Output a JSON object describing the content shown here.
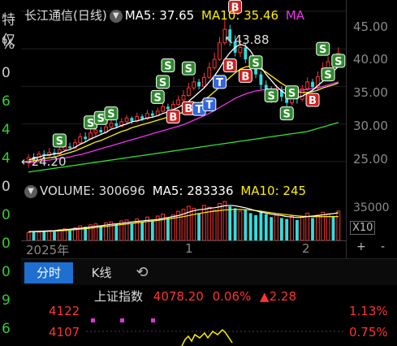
{
  "left_strip": {
    "items": [
      {
        "text": "特仅",
        "color": "#cccccc"
      },
      {
        "text": "%",
        "color": "#cccccc"
      },
      {
        "text": "0",
        "color": "#cccccc"
      },
      {
        "text": "6",
        "color": "#33cc33"
      },
      {
        "text": "4",
        "color": "#33cc33"
      },
      {
        "text": "4",
        "color": "#33cc33"
      },
      {
        "text": "0",
        "color": "#cccccc"
      },
      {
        "text": "0",
        "color": "#33cc33"
      },
      {
        "text": "0",
        "color": "#33cc33"
      },
      {
        "text": "0",
        "color": "#33cc33"
      },
      {
        "text": "9",
        "color": "#33cc33"
      },
      {
        "text": "6",
        "color": "#33cc33"
      }
    ]
  },
  "chart_header": {
    "title": "长江通信(日线)",
    "ma5_label": "MA5: 37.65",
    "ma10_label": "MA10: 35.46",
    "ma_cut": "MA"
  },
  "price_axis": {
    "ticks": [
      "45.00",
      "40.00",
      "35.00",
      "30.00",
      "25.00"
    ]
  },
  "annotations": {
    "high": "43.88",
    "low": "24.20"
  },
  "volume_header": {
    "label": "VOLUME: 300696",
    "ma5": "MA5: 283336",
    "ma10": "MA10: 245"
  },
  "volume_axis": {
    "tick": "35000",
    "unit": "X10",
    "plus": "+",
    "minus": "-"
  },
  "date_labels": {
    "year": "2025年",
    "m1": "1",
    "m2": "2"
  },
  "tabs": {
    "timeshare": "分时",
    "kline": "K线"
  },
  "index_bar": {
    "name": "上证指数",
    "value": "4078.20",
    "pct": "0.06%",
    "change": "▲2.28",
    "y1": "4122",
    "y2": "4107",
    "p1": "1.13%",
    "p2": "0.75%"
  },
  "colors": {
    "up": "#ff3333",
    "down": "#33dddd",
    "ma5": "#ffffff",
    "ma10": "#ffee00",
    "ma20": "#ee33ee",
    "ma60": "#33dd33",
    "buy_marker": "#2e8b2e",
    "sell_marker": "#cc2222",
    "t_marker": "#3366dd",
    "tab_active": "#1e6fd0"
  },
  "chart_data": {
    "type": "candlestick",
    "title": "长江通信(日线)",
    "y_range": [
      22.5,
      46.5
    ],
    "high": 43.88,
    "low": 24.2,
    "candles": [
      [
        24.8,
        25.5,
        24.2,
        26.0
      ],
      [
        25.5,
        25.2,
        24.8,
        26.1
      ],
      [
        25.2,
        26.0,
        25.0,
        26.4
      ],
      [
        26.0,
        25.8,
        25.5,
        26.5
      ],
      [
        25.8,
        26.2,
        25.6,
        26.8
      ],
      [
        26.2,
        26.0,
        25.7,
        26.7
      ],
      [
        26.0,
        26.6,
        25.9,
        27.0
      ],
      [
        26.6,
        27.0,
        26.3,
        27.4
      ],
      [
        27.0,
        26.8,
        26.5,
        27.5
      ],
      [
        26.8,
        27.5,
        26.7,
        28.0
      ],
      [
        27.5,
        28.3,
        27.2,
        28.8
      ],
      [
        28.3,
        28.0,
        27.6,
        28.9
      ],
      [
        28.0,
        28.8,
        27.9,
        29.4
      ],
      [
        28.8,
        29.2,
        28.4,
        29.8
      ],
      [
        29.2,
        28.9,
        28.6,
        29.6
      ],
      [
        28.9,
        29.6,
        28.7,
        30.1
      ],
      [
        29.6,
        30.1,
        29.3,
        30.6
      ],
      [
        30.1,
        29.7,
        29.4,
        30.5
      ],
      [
        29.7,
        30.3,
        29.6,
        30.8
      ],
      [
        30.3,
        30.8,
        30.0,
        31.2
      ],
      [
        30.8,
        30.4,
        30.0,
        31.0
      ],
      [
        30.4,
        31.0,
        30.2,
        31.5
      ],
      [
        31.0,
        30.7,
        30.4,
        31.3
      ],
      [
        30.7,
        31.4,
        30.5,
        31.9
      ],
      [
        31.4,
        31.1,
        30.8,
        31.8
      ],
      [
        31.1,
        31.7,
        31.0,
        32.2
      ],
      [
        31.7,
        32.3,
        31.5,
        32.8
      ],
      [
        32.3,
        32.0,
        31.6,
        32.7
      ],
      [
        32.0,
        32.6,
        31.9,
        33.1
      ],
      [
        32.6,
        33.2,
        32.4,
        33.8
      ],
      [
        33.2,
        33.8,
        33.0,
        34.5
      ],
      [
        33.8,
        34.8,
        33.6,
        35.5
      ],
      [
        34.8,
        35.6,
        34.5,
        36.3
      ],
      [
        35.6,
        35.0,
        34.6,
        36.0
      ],
      [
        35.0,
        36.2,
        34.8,
        36.8
      ],
      [
        36.2,
        37.5,
        36.0,
        38.2
      ],
      [
        37.5,
        38.6,
        37.2,
        39.5
      ],
      [
        38.6,
        40.8,
        38.4,
        41.6
      ],
      [
        40.8,
        42.6,
        40.5,
        43.88
      ],
      [
        42.6,
        41.0,
        40.4,
        43.2
      ],
      [
        41.0,
        39.5,
        39.0,
        41.8
      ],
      [
        39.5,
        40.2,
        38.9,
        41.0
      ],
      [
        40.2,
        38.6,
        38.1,
        40.8
      ],
      [
        38.6,
        37.8,
        37.1,
        39.2
      ],
      [
        37.8,
        36.6,
        36.1,
        38.4
      ],
      [
        36.6,
        35.2,
        34.6,
        37.0
      ],
      [
        35.2,
        34.3,
        33.5,
        35.8
      ],
      [
        34.3,
        33.4,
        32.8,
        35.0
      ],
      [
        33.4,
        34.6,
        33.0,
        35.2
      ],
      [
        34.6,
        33.6,
        33.0,
        35.0
      ],
      [
        33.6,
        32.8,
        32.2,
        34.2
      ],
      [
        32.8,
        33.9,
        32.5,
        34.5
      ],
      [
        33.9,
        33.3,
        32.7,
        34.4
      ],
      [
        33.3,
        34.7,
        33.0,
        35.2
      ],
      [
        34.7,
        35.6,
        34.4,
        36.2
      ],
      [
        35.6,
        34.9,
        34.3,
        36.0
      ],
      [
        34.9,
        36.3,
        34.6,
        37.0
      ],
      [
        36.3,
        37.4,
        36.0,
        38.2
      ],
      [
        37.4,
        38.3,
        37.0,
        39.0
      ],
      [
        38.3,
        38.0,
        37.5,
        39.2
      ],
      [
        38.0,
        39.4,
        37.8,
        40.2
      ]
    ],
    "ma5": [
      25.2,
      25.4,
      25.6,
      25.8,
      25.9,
      26.0,
      26.1,
      26.4,
      26.6,
      26.9,
      27.3,
      27.6,
      28.0,
      28.3,
      28.6,
      28.9,
      29.3,
      29.5,
      29.8,
      30.0,
      30.3,
      30.4,
      30.6,
      30.8,
      30.9,
      31.1,
      31.4,
      31.6,
      31.9,
      32.2,
      32.6,
      33.0,
      33.6,
      34.2,
      34.8,
      35.6,
      36.4,
      37.4,
      38.6,
      39.5,
      40.2,
      40.6,
      40.4,
      39.7,
      38.6,
      37.6,
      36.6,
      35.8,
      35.0,
      34.4,
      33.9,
      33.6,
      33.5,
      33.7,
      34.1,
      34.5,
      35.1,
      35.7,
      36.4,
      37.0,
      37.65
    ],
    "ma10": [
      25.0,
      25.1,
      25.2,
      25.4,
      25.5,
      25.6,
      25.8,
      26.0,
      26.2,
      26.4,
      26.7,
      27.0,
      27.3,
      27.6,
      27.8,
      28.1,
      28.4,
      28.7,
      29.0,
      29.2,
      29.5,
      29.7,
      29.9,
      30.1,
      30.3,
      30.5,
      30.7,
      30.9,
      31.1,
      31.3,
      31.6,
      31.9,
      32.3,
      32.7,
      33.2,
      33.7,
      34.3,
      34.9,
      35.6,
      36.2,
      36.8,
      37.3,
      37.6,
      37.7,
      37.6,
      37.3,
      36.9,
      36.4,
      35.9,
      35.4,
      35.0,
      34.6,
      34.3,
      34.2,
      34.2,
      34.3,
      34.5,
      34.8,
      35.0,
      35.2,
      35.46
    ],
    "ma20": [
      24.8,
      24.9,
      25.0,
      25.1,
      25.2,
      25.3,
      25.4,
      25.5,
      25.6,
      25.8,
      25.9,
      26.1,
      26.3,
      26.5,
      26.7,
      26.9,
      27.1,
      27.3,
      27.5,
      27.7,
      27.9,
      28.1,
      28.3,
      28.5,
      28.7,
      28.9,
      29.1,
      29.3,
      29.5,
      29.7,
      29.9,
      30.2,
      30.5,
      30.8,
      31.1,
      31.4,
      31.8,
      32.2,
      32.6,
      33.0,
      33.4,
      33.7,
      34.0,
      34.2,
      34.4,
      34.5,
      34.6,
      34.6,
      34.6,
      34.6,
      34.5,
      34.5,
      34.5,
      34.5,
      34.6,
      34.7,
      34.8,
      35.0,
      35.2,
      35.4,
      35.6
    ],
    "ma60": [
      23.6,
      23.7,
      23.8,
      23.9,
      24.0,
      24.1,
      24.2,
      24.3,
      24.4,
      24.5,
      24.6,
      24.7,
      24.8,
      24.9,
      25.0,
      25.1,
      25.2,
      25.3,
      25.4,
      25.5,
      25.6,
      25.7,
      25.8,
      25.9,
      26.0,
      26.1,
      26.2,
      26.3,
      26.4,
      26.5,
      26.6,
      26.7,
      26.8,
      26.9,
      27.0,
      27.1,
      27.2,
      27.3,
      27.4,
      27.5,
      27.6,
      27.7,
      27.8,
      27.9,
      28.0,
      28.1,
      28.2,
      28.3,
      28.4,
      28.5,
      28.6,
      28.7,
      28.8,
      28.9,
      29.0,
      29.2,
      29.4,
      29.6,
      29.8,
      30.0,
      30.2
    ],
    "volume": [
      80000,
      90000,
      85000,
      95000,
      100000,
      90000,
      110000,
      120000,
      100000,
      130000,
      150000,
      140000,
      160000,
      170000,
      150000,
      180000,
      190000,
      170000,
      200000,
      210000,
      180000,
      220000,
      190000,
      240000,
      200000,
      250000,
      270000,
      230000,
      260000,
      300000,
      320000,
      350000,
      330000,
      280000,
      360000,
      340000,
      310000,
      380000,
      400000,
      350000,
      330000,
      300000,
      320000,
      280000,
      260000,
      300000,
      270000,
      240000,
      260000,
      230000,
      220000,
      250000,
      210000,
      240000,
      280000,
      230000,
      260000,
      290000,
      270000,
      250000,
      300696
    ],
    "vol_ma5": [
      90000,
      92000,
      94000,
      96000,
      98000,
      100000,
      105000,
      110000,
      115000,
      120000,
      125000,
      130000,
      138000,
      145000,
      150000,
      158000,
      165000,
      170000,
      175000,
      182000,
      190000,
      195000,
      200000,
      205000,
      210000,
      215000,
      225000,
      235000,
      245000,
      255000,
      270000,
      290000,
      305000,
      315000,
      320000,
      330000,
      335000,
      345000,
      355000,
      360000,
      355000,
      345000,
      335000,
      320000,
      305000,
      290000,
      280000,
      270000,
      262000,
      255000,
      245000,
      240000,
      235000,
      238000,
      245000,
      250000,
      255000,
      262000,
      270000,
      275000,
      283336
    ],
    "vol_ma10": [
      88000,
      89000,
      90000,
      92000,
      94000,
      96000,
      99000,
      102000,
      106000,
      110000,
      115000,
      120000,
      126000,
      132000,
      138000,
      144000,
      150000,
      156000,
      162000,
      168000,
      175000,
      181000,
      187000,
      193000,
      199000,
      205000,
      212000,
      220000,
      228000,
      236000,
      244000,
      255000,
      266000,
      276000,
      285000,
      293000,
      300000,
      306000,
      312000,
      316000,
      318000,
      318000,
      316000,
      312000,
      306000,
      300000,
      292000,
      284000,
      276000,
      270000,
      264000,
      258000,
      252000,
      248000,
      246000,
      244000,
      244000,
      244000,
      245000,
      245000,
      245000
    ],
    "signals": [
      {
        "type": "S",
        "i": 6,
        "price": 27.8
      },
      {
        "type": "S",
        "i": 12,
        "price": 30.2
      },
      {
        "type": "S",
        "i": 14,
        "price": 30.8
      },
      {
        "type": "S",
        "i": 16,
        "price": 31.4
      },
      {
        "type": "S",
        "i": 25,
        "price": 33.6
      },
      {
        "type": "S",
        "i": 26,
        "price": 35.6
      },
      {
        "type": "S",
        "i": 27,
        "price": 37.8
      },
      {
        "type": "S",
        "i": 31,
        "price": 37.4
      },
      {
        "type": "B",
        "i": 28,
        "price": 31.0
      },
      {
        "type": "B",
        "i": 31,
        "price": 32.1
      },
      {
        "type": "T",
        "i": 33,
        "price": 32.0
      },
      {
        "type": "T",
        "i": 35,
        "price": 32.6
      },
      {
        "type": "T",
        "i": 37,
        "price": 35.6
      },
      {
        "type": "B",
        "i": 39,
        "price": 37.8
      },
      {
        "type": "B",
        "i": 42,
        "price": 36.4
      },
      {
        "type": "B",
        "i": 40,
        "price": 45.6
      },
      {
        "type": "S",
        "i": 44,
        "price": 38.2
      },
      {
        "type": "S",
        "i": 47,
        "price": 33.8
      },
      {
        "type": "S",
        "i": 50,
        "price": 31.4
      },
      {
        "type": "S",
        "i": 51,
        "price": 34.2
      },
      {
        "type": "B",
        "i": 55,
        "price": 33.2
      },
      {
        "type": "S",
        "i": 57,
        "price": 40.0
      },
      {
        "type": "S",
        "i": 58,
        "price": 36.6
      },
      {
        "type": "S",
        "i": 60,
        "price": 38.4
      }
    ]
  }
}
